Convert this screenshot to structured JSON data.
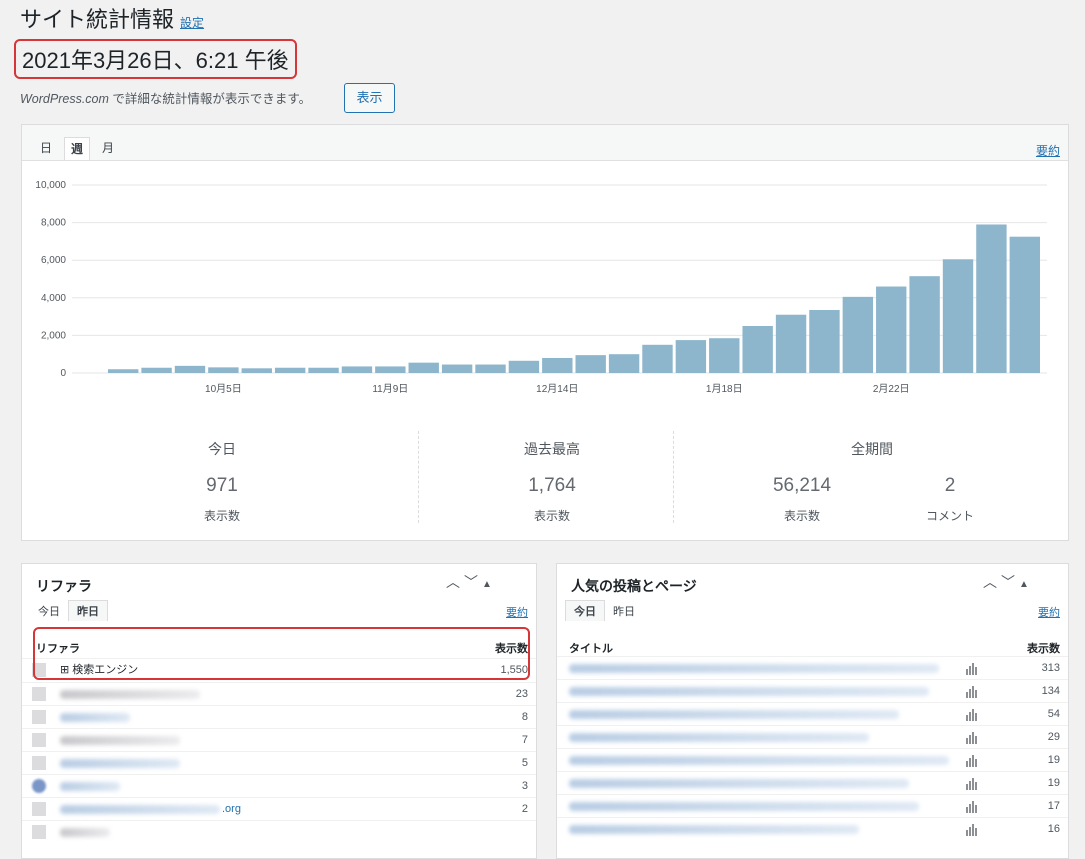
{
  "header": {
    "title": "サイト統計情報",
    "settings_link": "設定",
    "datetime": "2021年3月26日、6:21 午後",
    "wpcom_note_brand": "WordPress.com",
    "wpcom_note_rest": " で詳細な統計情報が表示できます。",
    "show_button": "表示"
  },
  "main_tabs": {
    "tabs": [
      "日",
      "週",
      "月"
    ],
    "active": "週",
    "summary_link": "要約"
  },
  "chart_data": {
    "type": "bar",
    "yticks": [
      "0",
      "2,000",
      "4,000",
      "6,000",
      "8,000",
      "10,000"
    ],
    "ylim": [
      0,
      10000
    ],
    "xtick_labels": [
      "10月5日",
      "11月9日",
      "12月14日",
      "1月18日",
      "2月22日"
    ],
    "xtick_bar_index": [
      3,
      8,
      13,
      18,
      23
    ],
    "values": [
      200,
      280,
      380,
      300,
      250,
      280,
      280,
      350,
      350,
      550,
      450,
      450,
      650,
      800,
      950,
      1000,
      1500,
      1750,
      1850,
      2500,
      3100,
      3350,
      4050,
      4600,
      5150,
      6050,
      7900,
      7250
    ],
    "bar_color": "#8db6cc",
    "grid": true
  },
  "summary": {
    "today": {
      "heading": "今日",
      "value": "971",
      "label": "表示数"
    },
    "best": {
      "heading": "過去最高",
      "value": "1,764",
      "label": "表示数"
    },
    "all": {
      "heading": "全期間",
      "views_value": "56,214",
      "views_label": "表示数",
      "comments_value": "2",
      "comments_label": "コメント"
    }
  },
  "referrers": {
    "title": "リファラ",
    "tabs": [
      "今日",
      "昨日"
    ],
    "active_tab": "昨日",
    "summary_link": "要約",
    "col_name": "リファラ",
    "col_views": "表示数",
    "rows": [
      {
        "label": "⊞ 検索エンジン",
        "views": "1,550"
      },
      {
        "label": "",
        "views": "23"
      },
      {
        "label": "",
        "views": "8"
      },
      {
        "label": "",
        "views": "7"
      },
      {
        "label": "",
        "views": "5"
      },
      {
        "label": "",
        "views": "3"
      },
      {
        "label": ".org",
        "views": "2"
      }
    ]
  },
  "popular": {
    "title": "人気の投稿とページ",
    "tabs": [
      "今日",
      "昨日"
    ],
    "active_tab": "今日",
    "summary_link": "要約",
    "col_title": "タイトル",
    "col_views": "表示数",
    "rows": [
      {
        "views": "313"
      },
      {
        "views": "134"
      },
      {
        "views": "54"
      },
      {
        "views": "29"
      },
      {
        "views": "19"
      },
      {
        "views": "19"
      },
      {
        "views": "17"
      },
      {
        "views": "16"
      }
    ]
  }
}
